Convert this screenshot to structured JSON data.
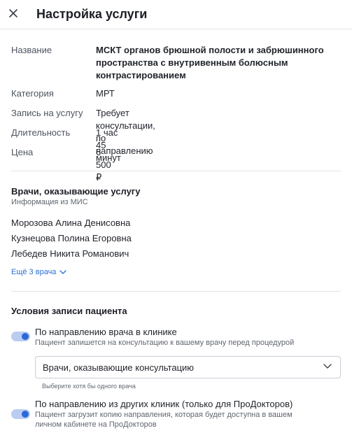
{
  "header": {
    "title": "Настройка услуги"
  },
  "details": {
    "name_label": "Название",
    "name_value": "МСКТ органов брюшной полости и забрюшинного пространства с внутривенным болюсным контрастированием",
    "category_label": "Категория",
    "category_value": "МРТ",
    "booking_label": "Запись на услугу",
    "booking_value": "Требует консультации, по направлению",
    "duration_label": "Длительность",
    "duration_value": "1 час 45 минут",
    "price_label": "Цена",
    "price_value": "6 500 ₽"
  },
  "doctors": {
    "title": "Врачи, оказывающие услугу",
    "subtitle": "Информация из МИС",
    "list": [
      "Морозова Алина Денисовна",
      "Кузнецова Полина Егоровна",
      "Лебедев Никита Романович"
    ],
    "more_label": "Ещё 3 врача"
  },
  "conditions": {
    "title": "Условия записи пациента",
    "option1": {
      "title": "По направлению врача в клинике",
      "description": "Пациент запишется на консультацию к вашему врачу перед процедурой",
      "enabled": true
    },
    "select": {
      "value": "Врачи, оказывающие консультацию",
      "hint": "Выберите хотя бы одного врача"
    },
    "option2": {
      "title": "По направлению из других клиник (только для ПроДокторов)",
      "description": "Пациент загрузит копию направления, которая будет доступна в вашем личном кабинете на ПроДокторов",
      "enabled": true
    }
  },
  "colors": {
    "accent": "#2b67d8",
    "link": "#2b6fd6",
    "toggle_track": "#b9cdf3"
  }
}
